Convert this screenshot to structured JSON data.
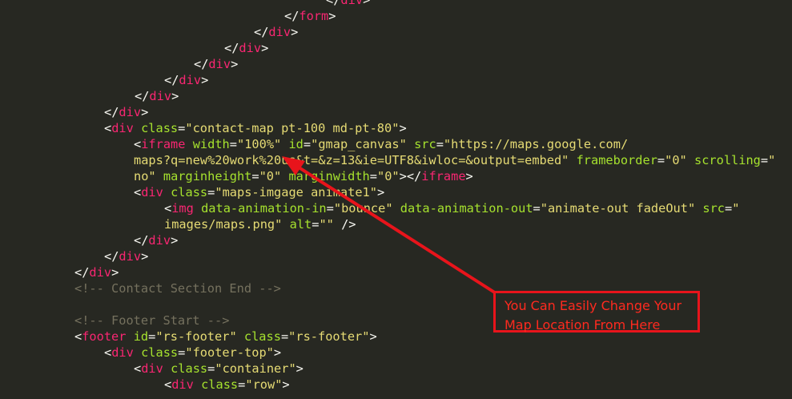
{
  "editor": {
    "lines": [
      [
        {
          "k": "t",
          "v": "</"
        },
        {
          "k": "tg",
          "v": "div"
        },
        {
          "k": "t",
          "v": ">"
        }
      ],
      [
        {
          "k": "t",
          "v": "</"
        },
        {
          "k": "tg",
          "v": "form"
        },
        {
          "k": "t",
          "v": ">"
        }
      ],
      [
        {
          "k": "t",
          "v": "</"
        },
        {
          "k": "tg",
          "v": "div"
        },
        {
          "k": "t",
          "v": ">"
        }
      ],
      [
        {
          "k": "t",
          "v": "</"
        },
        {
          "k": "tg",
          "v": "div"
        },
        {
          "k": "t",
          "v": ">"
        }
      ],
      [
        {
          "k": "t",
          "v": "</"
        },
        {
          "k": "tg",
          "v": "div"
        },
        {
          "k": "t",
          "v": ">"
        }
      ],
      [
        {
          "k": "t",
          "v": "</"
        },
        {
          "k": "tg",
          "v": "div"
        },
        {
          "k": "t",
          "v": ">"
        }
      ],
      [
        {
          "k": "t",
          "v": "</"
        },
        {
          "k": "tg",
          "v": "div"
        },
        {
          "k": "t",
          "v": ">"
        }
      ],
      [
        {
          "k": "t",
          "v": "</"
        },
        {
          "k": "tg",
          "v": "div"
        },
        {
          "k": "t",
          "v": ">"
        }
      ],
      [
        {
          "k": "t",
          "v": "<"
        },
        {
          "k": "tg",
          "v": "div"
        },
        {
          "k": "t",
          "v": " "
        },
        {
          "k": "at",
          "v": "class"
        },
        {
          "k": "t",
          "v": "="
        },
        {
          "k": "st",
          "v": "\"contact-map pt-100 md-pt-80\""
        },
        {
          "k": "t",
          "v": ">"
        }
      ],
      [
        {
          "k": "t",
          "v": "<"
        },
        {
          "k": "tg",
          "v": "iframe"
        },
        {
          "k": "t",
          "v": " "
        },
        {
          "k": "at",
          "v": "width"
        },
        {
          "k": "t",
          "v": "="
        },
        {
          "k": "st",
          "v": "\"100%\""
        },
        {
          "k": "t",
          "v": " "
        },
        {
          "k": "at",
          "v": "id"
        },
        {
          "k": "t",
          "v": "="
        },
        {
          "k": "st",
          "v": "\"gmap_canvas\""
        },
        {
          "k": "t",
          "v": " "
        },
        {
          "k": "at",
          "v": "src"
        },
        {
          "k": "t",
          "v": "="
        },
        {
          "k": "st",
          "v": "\"https://maps.google.com/"
        }
      ],
      [
        {
          "k": "st",
          "v": "maps?q=new%20work%20us&t=&z=13&ie=UTF8&iwloc=&output=embed\""
        },
        {
          "k": "t",
          "v": " "
        },
        {
          "k": "at",
          "v": "frameborder"
        },
        {
          "k": "t",
          "v": "="
        },
        {
          "k": "st",
          "v": "\"0\""
        },
        {
          "k": "t",
          "v": " "
        },
        {
          "k": "at",
          "v": "scrolling"
        },
        {
          "k": "t",
          "v": "="
        },
        {
          "k": "st",
          "v": "\""
        }
      ],
      [
        {
          "k": "st",
          "v": "no\""
        },
        {
          "k": "t",
          "v": " "
        },
        {
          "k": "at",
          "v": "marginheight"
        },
        {
          "k": "t",
          "v": "="
        },
        {
          "k": "st",
          "v": "\"0\""
        },
        {
          "k": "t",
          "v": " "
        },
        {
          "k": "at",
          "v": "marginwidth"
        },
        {
          "k": "t",
          "v": "="
        },
        {
          "k": "st",
          "v": "\"0\""
        },
        {
          "k": "t",
          "v": "></"
        },
        {
          "k": "tg",
          "v": "iframe"
        },
        {
          "k": "t",
          "v": ">"
        }
      ],
      [
        {
          "k": "t",
          "v": "<"
        },
        {
          "k": "tg",
          "v": "div"
        },
        {
          "k": "t",
          "v": " "
        },
        {
          "k": "at",
          "v": "class"
        },
        {
          "k": "t",
          "v": "="
        },
        {
          "k": "st",
          "v": "\"maps-imgage animate1\""
        },
        {
          "k": "t",
          "v": ">"
        }
      ],
      [
        {
          "k": "t",
          "v": "<"
        },
        {
          "k": "tg",
          "v": "img"
        },
        {
          "k": "t",
          "v": " "
        },
        {
          "k": "at",
          "v": "data-animation-in"
        },
        {
          "k": "t",
          "v": "="
        },
        {
          "k": "st",
          "v": "\"bounce\""
        },
        {
          "k": "t",
          "v": " "
        },
        {
          "k": "at",
          "v": "data-animation-out"
        },
        {
          "k": "t",
          "v": "="
        },
        {
          "k": "st",
          "v": "\"animate-out fadeOut\""
        },
        {
          "k": "t",
          "v": " "
        },
        {
          "k": "at",
          "v": "src"
        },
        {
          "k": "t",
          "v": "="
        },
        {
          "k": "st",
          "v": "\""
        }
      ],
      [
        {
          "k": "st",
          "v": "images/maps.png\""
        },
        {
          "k": "t",
          "v": " "
        },
        {
          "k": "at",
          "v": "alt"
        },
        {
          "k": "t",
          "v": "="
        },
        {
          "k": "st",
          "v": "\"\""
        },
        {
          "k": "t",
          "v": " />"
        }
      ],
      [
        {
          "k": "t",
          "v": "</"
        },
        {
          "k": "tg",
          "v": "div"
        },
        {
          "k": "t",
          "v": ">"
        }
      ],
      [
        {
          "k": "t",
          "v": "</"
        },
        {
          "k": "tg",
          "v": "div"
        },
        {
          "k": "t",
          "v": ">"
        }
      ],
      [
        {
          "k": "t",
          "v": "</"
        },
        {
          "k": "tg",
          "v": "div"
        },
        {
          "k": "t",
          "v": ">"
        }
      ],
      [
        {
          "k": "cm",
          "v": "<!-- Contact Section End -->"
        }
      ],
      [],
      [
        {
          "k": "cm",
          "v": "<!-- Footer Start -->"
        }
      ],
      [
        {
          "k": "t",
          "v": "<"
        },
        {
          "k": "tg",
          "v": "footer"
        },
        {
          "k": "t",
          "v": " "
        },
        {
          "k": "at",
          "v": "id"
        },
        {
          "k": "t",
          "v": "="
        },
        {
          "k": "st",
          "v": "\"rs-footer\""
        },
        {
          "k": "t",
          "v": " "
        },
        {
          "k": "at",
          "v": "class"
        },
        {
          "k": "t",
          "v": "="
        },
        {
          "k": "st",
          "v": "\"rs-footer\""
        },
        {
          "k": "t",
          "v": ">"
        }
      ],
      [
        {
          "k": "t",
          "v": "<"
        },
        {
          "k": "tg",
          "v": "div"
        },
        {
          "k": "t",
          "v": " "
        },
        {
          "k": "at",
          "v": "class"
        },
        {
          "k": "t",
          "v": "="
        },
        {
          "k": "st",
          "v": "\"footer-top\""
        },
        {
          "k": "t",
          "v": ">"
        }
      ],
      [
        {
          "k": "t",
          "v": "<"
        },
        {
          "k": "tg",
          "v": "div"
        },
        {
          "k": "t",
          "v": " "
        },
        {
          "k": "at",
          "v": "class"
        },
        {
          "k": "t",
          "v": "="
        },
        {
          "k": "st",
          "v": "\"container\""
        },
        {
          "k": "t",
          "v": ">"
        }
      ],
      [
        {
          "k": "t",
          "v": "<"
        },
        {
          "k": "tg",
          "v": "div"
        },
        {
          "k": "t",
          "v": " "
        },
        {
          "k": "at",
          "v": "class"
        },
        {
          "k": "t",
          "v": "="
        },
        {
          "k": "st",
          "v": "\"row\""
        },
        {
          "k": "t",
          "v": ">"
        }
      ]
    ]
  },
  "annotation": {
    "line1": "You Can Easily Change Your",
    "line2": "Map Location From Here"
  },
  "colors": {
    "background": "#272822",
    "plain": "#f8f8f2",
    "tag": "#f92672",
    "attribute": "#a6e22e",
    "string": "#e6db74",
    "comment": "#75715e",
    "annotation": "#e8141b"
  }
}
